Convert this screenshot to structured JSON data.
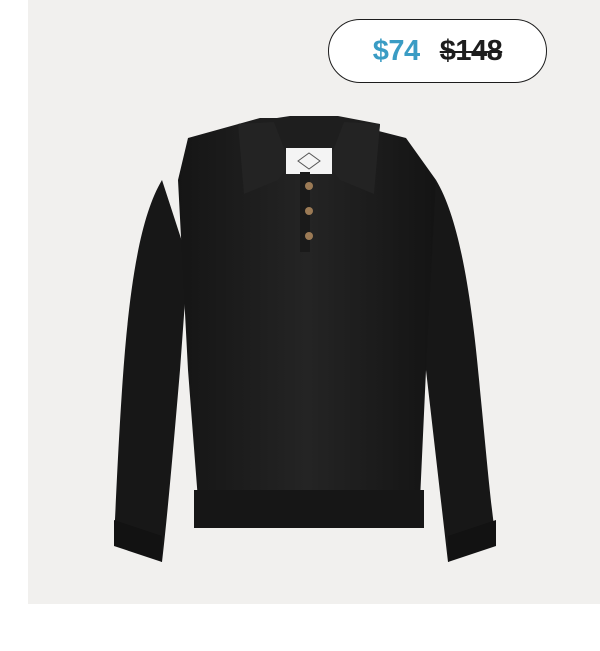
{
  "product": {
    "image_icon": "black-knit-polo-sweater",
    "sale_price": "$74",
    "original_price": "$148"
  },
  "colors": {
    "background": "#f1f0ee",
    "sale_price": "#3a9cc4",
    "original_price": "#1d1d1d",
    "garment": "#1c1c1c",
    "buttons": "#9b7a55"
  }
}
